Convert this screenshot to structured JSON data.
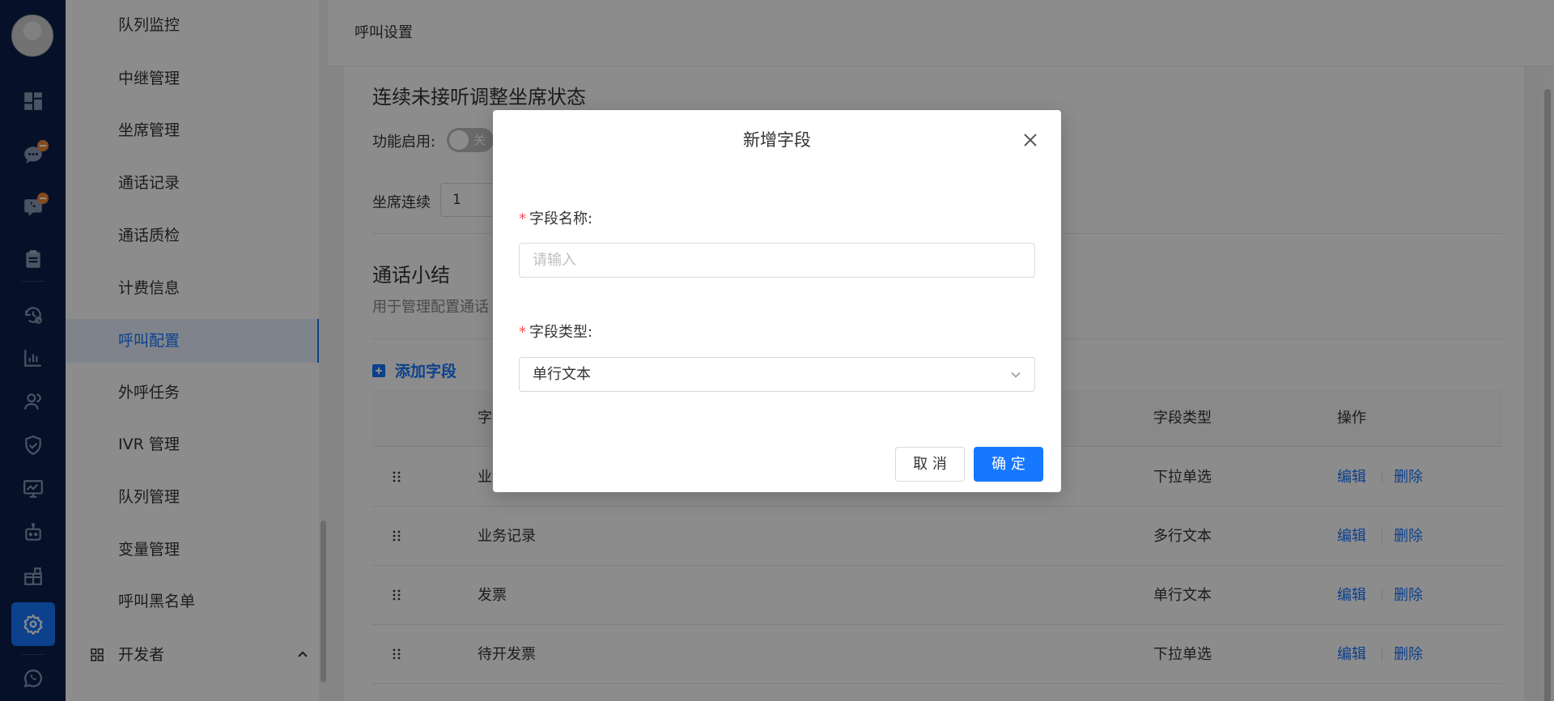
{
  "sidebar": {
    "icons": [
      "dashboard-icon",
      "chat-icon",
      "phone-chat-icon",
      "clipboard-icon",
      "history-icon",
      "bar-chart-icon",
      "users-icon",
      "shield-icon",
      "monitor-chart-icon",
      "robot-icon",
      "gift-icon",
      "gear-icon",
      "whatsapp-icon"
    ],
    "accent": "#1677ff",
    "bg": "#0c1f4b"
  },
  "menu": {
    "items": [
      {
        "label": "队列监控"
      },
      {
        "label": "中继管理"
      },
      {
        "label": "坐席管理"
      },
      {
        "label": "通话记录"
      },
      {
        "label": "通话质检"
      },
      {
        "label": "计费信息"
      },
      {
        "label": "呼叫配置"
      },
      {
        "label": "外呼任务"
      },
      {
        "label": "IVR 管理"
      },
      {
        "label": "队列管理"
      },
      {
        "label": "变量管理"
      },
      {
        "label": "呼叫黑名单"
      }
    ],
    "active_index": 6,
    "developer_label": "开发者"
  },
  "header": {
    "title": "呼叫设置"
  },
  "content": {
    "section1_title": "连续未接听调整坐席状态",
    "enable_label": "功能启用:",
    "toggle_text": "关",
    "agent_label": "坐席连续",
    "agent_value": "1",
    "section2_title": "通话小结",
    "section2_sub": "用于管理配置通话",
    "add_field_label": "添加字段",
    "table": {
      "headers": [
        "字",
        "字段类型",
        "操作"
      ],
      "rows": [
        {
          "name": "业",
          "type": "下拉单选",
          "edit": "编辑",
          "delete": "删除"
        },
        {
          "name": "业务记录",
          "type": "多行文本",
          "edit": "编辑",
          "delete": "删除"
        },
        {
          "name": "发票",
          "type": "单行文本",
          "edit": "编辑",
          "delete": "删除"
        },
        {
          "name": "待开发票",
          "type": "下拉单选",
          "edit": "编辑",
          "delete": "删除"
        }
      ]
    }
  },
  "modal": {
    "title": "新增字段",
    "required_mark": "*",
    "name_label": "字段名称:",
    "name_placeholder": "请输入",
    "type_label": "字段类型:",
    "type_value": "单行文本",
    "cancel_label": "取 消",
    "ok_label": "确 定"
  }
}
